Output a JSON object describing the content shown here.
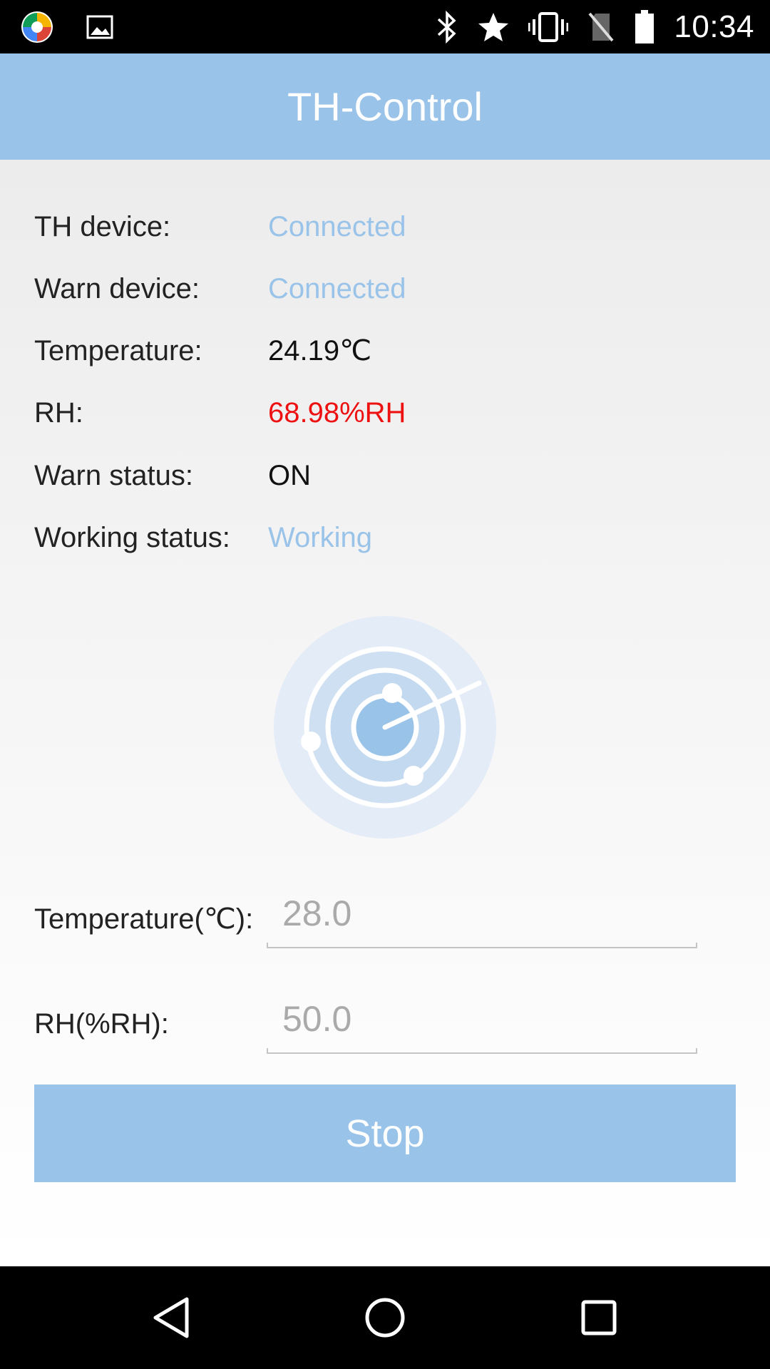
{
  "status_bar": {
    "time": "10:34",
    "left_icons": [
      "app-logo-icon",
      "image-icon"
    ],
    "right_icons": [
      "bluetooth-icon",
      "star-icon",
      "vibrate-icon",
      "no-sim-icon",
      "battery-icon"
    ]
  },
  "app_bar": {
    "title": "TH-Control"
  },
  "info": {
    "th_device": {
      "label": "TH device:",
      "value": "Connected",
      "color": "#9ac3e9"
    },
    "warn_device": {
      "label": "Warn device:",
      "value": "Connected",
      "color": "#9ac3e9"
    },
    "temperature": {
      "label": "Temperature:",
      "value": "24.19℃",
      "color": "#111111"
    },
    "rh": {
      "label": "RH:",
      "value": "68.98%RH",
      "color": "#ee1111"
    },
    "warn_status": {
      "label": "Warn status:",
      "value": "ON",
      "color": "#111111"
    },
    "working_status": {
      "label": "Working status:",
      "value": "Working",
      "color": "#9ac3e9"
    }
  },
  "radar": {
    "icon": "radar-icon"
  },
  "settings": {
    "temperature": {
      "label": "Temperature(℃):",
      "placeholder": "28.0"
    },
    "rh": {
      "label": "RH(%RH):",
      "placeholder": "50.0"
    }
  },
  "stop_button": {
    "label": "Stop"
  },
  "nav": {
    "icons": [
      "back-icon",
      "home-icon",
      "recents-icon"
    ]
  },
  "colors": {
    "accent": "#9ac3e9",
    "warning": "#ee1111"
  }
}
